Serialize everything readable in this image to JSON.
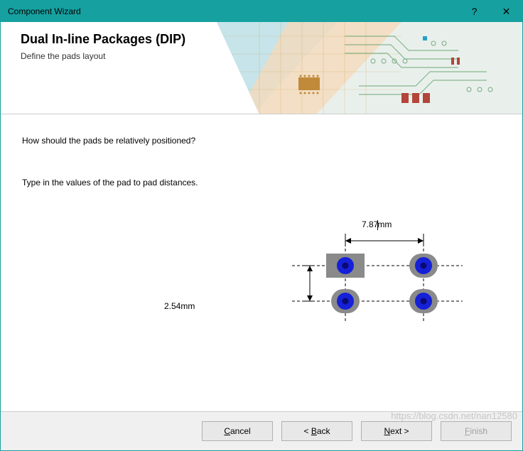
{
  "window": {
    "title": "Component Wizard"
  },
  "titlebar_icons": {
    "help": "?",
    "close": "✕"
  },
  "header": {
    "title": "Dual In-line Packages (DIP)",
    "subtitle": "Define the pads layout"
  },
  "content": {
    "question1": "How should the pads be relatively positioned?",
    "question2": "Type in the values of the pad to pad distances.",
    "horizontal_distance": "7.87mm",
    "vertical_distance": "2.54mm"
  },
  "buttons": {
    "cancel": "Cancel",
    "back": "< Back",
    "next": "Next >",
    "finish": "Finish"
  },
  "watermark": "https://blog.csdn.net/nan12580"
}
